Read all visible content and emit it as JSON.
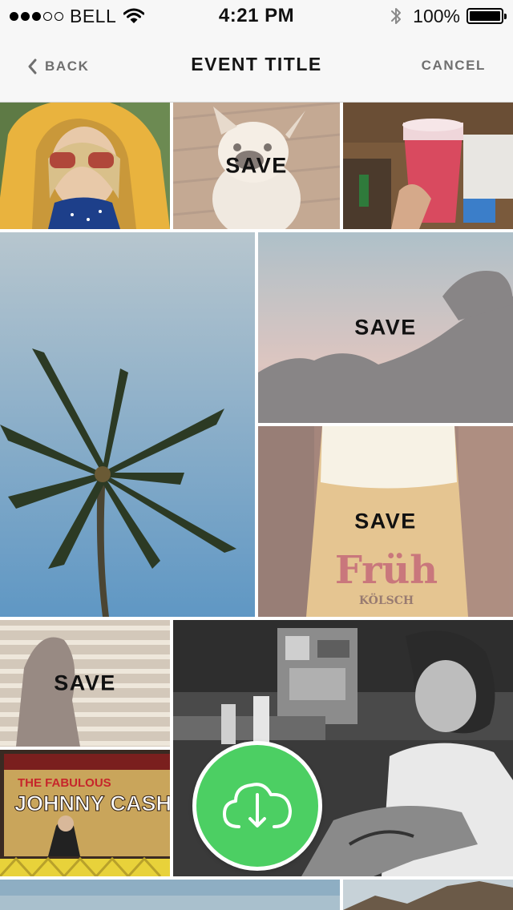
{
  "status_bar": {
    "carrier": "BELL",
    "time": "4:21 PM",
    "battery_percent": "100%",
    "signal_strength": 3,
    "signal_max": 5,
    "icons": [
      "signal-dots-icon",
      "wifi-icon",
      "bluetooth-icon",
      "battery-icon"
    ]
  },
  "nav": {
    "back_label": "BACK",
    "title": "EVENT TITLE",
    "cancel_label": "CANCEL",
    "icons": [
      "chevron-left-icon"
    ]
  },
  "grid": {
    "save_label": "SAVE",
    "photos": [
      {
        "subject": "girl in yellow hood",
        "save_overlay": false
      },
      {
        "subject": "french bulldog",
        "save_overlay": true
      },
      {
        "subject": "pink drink on table",
        "save_overlay": false
      },
      {
        "subject": "palm tree against sky",
        "save_overlay": false
      },
      {
        "subject": "dusk sky over hills",
        "save_overlay": true
      },
      {
        "subject": "glass of beer",
        "save_overlay": true
      },
      {
        "subject": "woman by shuttered window",
        "save_overlay": true
      },
      {
        "subject": "tattoo artist at work",
        "save_overlay": false
      },
      {
        "subject": "vinyl record crate",
        "save_overlay": false
      },
      {
        "subject": "landscape",
        "save_overlay": false
      },
      {
        "subject": "mountain landscape",
        "save_overlay": false
      }
    ],
    "record_cover": {
      "line1": "THE FABULOUS",
      "line2": "JOHNNY CASH"
    },
    "beer_brand": {
      "name": "Früh",
      "sub": "KÖLSCH"
    }
  },
  "fab": {
    "icon": "cloud-download-icon",
    "color": "#4ccf63"
  },
  "colors": {
    "bar_background": "#f7f7f7",
    "nav_link": "#6f6f6f",
    "accent_green": "#4ccf63"
  }
}
